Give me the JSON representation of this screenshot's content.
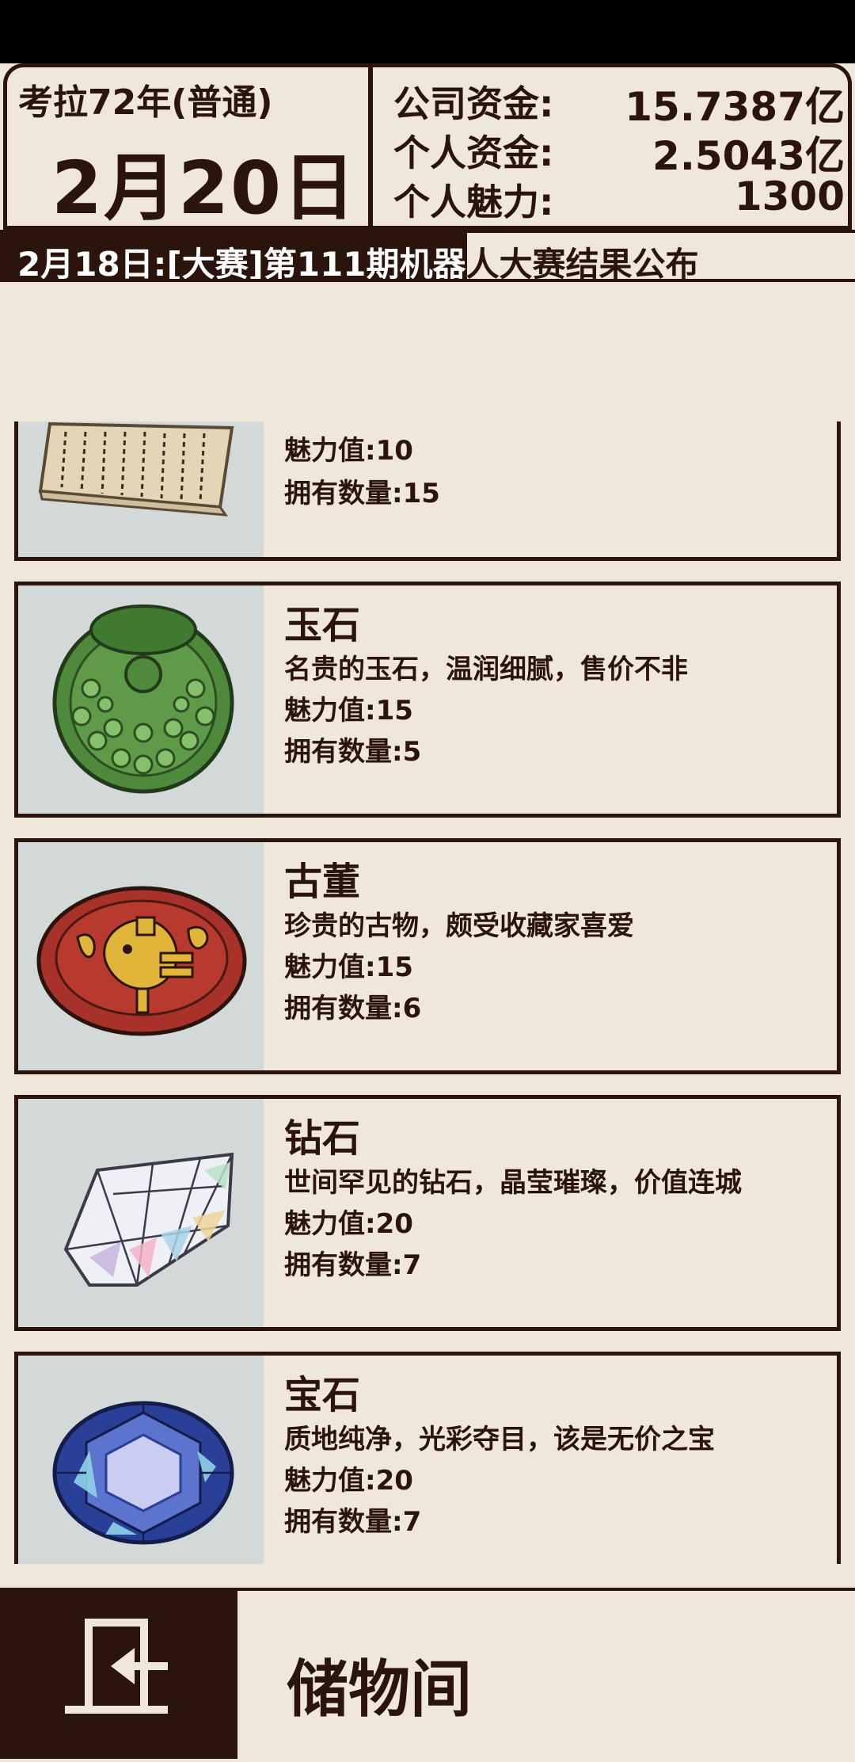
{
  "header": {
    "year": "考拉72年(普通)",
    "date": "2月20日",
    "company_funds_label": "公司资金:",
    "company_funds_value": "15.7387亿",
    "personal_funds_label": "个人资金:",
    "personal_funds_value": "2.5043亿",
    "charm_label": "个人魅力:",
    "charm_value": "1300"
  },
  "news": {
    "text": "2月18日:[大赛]第111期机器人大赛结果公布"
  },
  "items": [
    {
      "name": "",
      "desc": "",
      "charm": "魅力值:10",
      "count": "拥有数量:15",
      "icon": "book-icon"
    },
    {
      "name": "玉石",
      "desc": "名贵的玉石，温润细腻，售价不非",
      "charm": "魅力值:15",
      "count": "拥有数量:5",
      "icon": "jade-icon"
    },
    {
      "name": "古董",
      "desc": "珍贵的古物，颇受收藏家喜爱",
      "charm": "魅力值:15",
      "count": "拥有数量:6",
      "icon": "antique-plate-icon"
    },
    {
      "name": "钻石",
      "desc": "世间罕见的钻石，晶莹璀璨，价值连城",
      "charm": "魅力值:20",
      "count": "拥有数量:7",
      "icon": "diamond-icon"
    },
    {
      "name": "宝石",
      "desc": "质地纯净，光彩夺目，该是无价之宝",
      "charm": "魅力值:20",
      "count": "拥有数量:7",
      "icon": "gem-icon"
    }
  ],
  "footer": {
    "title": "储物间",
    "exit_icon": "exit-icon"
  },
  "colors": {
    "dark": "#2b140b",
    "paper": "#efe7da",
    "image_bg": "#d3d8d8"
  }
}
